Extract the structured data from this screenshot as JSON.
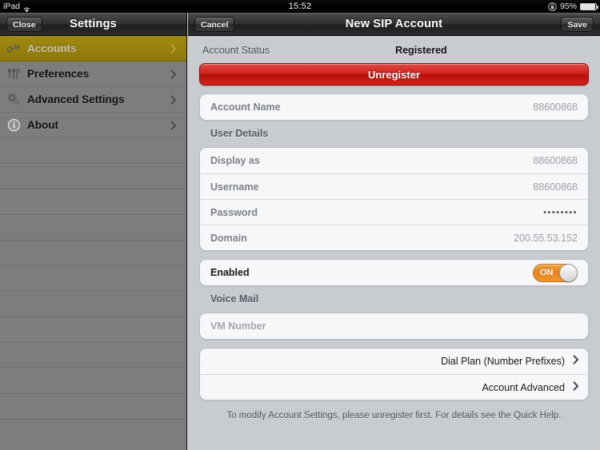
{
  "statusbar": {
    "carrier": "iPad",
    "wifi_icon": "wifi-icon",
    "time": "15:52",
    "lock_icon": "rotation-lock-icon",
    "battery_percent": "95%",
    "battery_icon": "battery-icon"
  },
  "left_toolbar": {
    "close_label": "Close",
    "title": "Settings"
  },
  "right_toolbar": {
    "cancel_label": "Cancel",
    "title": "New SIP Account",
    "save_label": "Save"
  },
  "sidebar": {
    "items": [
      {
        "label": "Accounts",
        "icon": "key-icon",
        "selected": true
      },
      {
        "label": "Preferences",
        "icon": "tools-icon",
        "selected": false
      },
      {
        "label": "Advanced Settings",
        "icon": "gears-icon",
        "selected": false
      },
      {
        "label": "About",
        "icon": "info-icon",
        "selected": false
      }
    ],
    "empty_row_count": 11
  },
  "content": {
    "account_status": {
      "label": "Account Status",
      "value": "Registered"
    },
    "unregister_button": "Unregister",
    "account_name": {
      "label": "Account Name",
      "value": "88600868"
    },
    "user_details": {
      "header": "User Details",
      "rows": [
        {
          "label": "Display as",
          "value": "88600868"
        },
        {
          "label": "Username",
          "value": "88600868"
        },
        {
          "label": "Password",
          "value": "••••••••"
        },
        {
          "label": "Domain",
          "value": "200.55.53.152"
        }
      ]
    },
    "enabled": {
      "label": "Enabled",
      "toggle_state": "ON"
    },
    "voice_mail": {
      "header": "Voice Mail",
      "vm_placeholder": "VM Number",
      "vm_value": ""
    },
    "nav_rows": [
      {
        "label": "Dial Plan (Number Prefixes)"
      },
      {
        "label": "Account Advanced"
      }
    ],
    "footnote": "To modify Account Settings, please unregister first.  For details see the Quick Help."
  },
  "colors": {
    "accent_selected": "#8e790c",
    "danger": "#cf1f18",
    "toggle_on": "#e8821a",
    "panel_bg": "#c8cbd0",
    "sidebar_bg": "#7d7d7d"
  }
}
